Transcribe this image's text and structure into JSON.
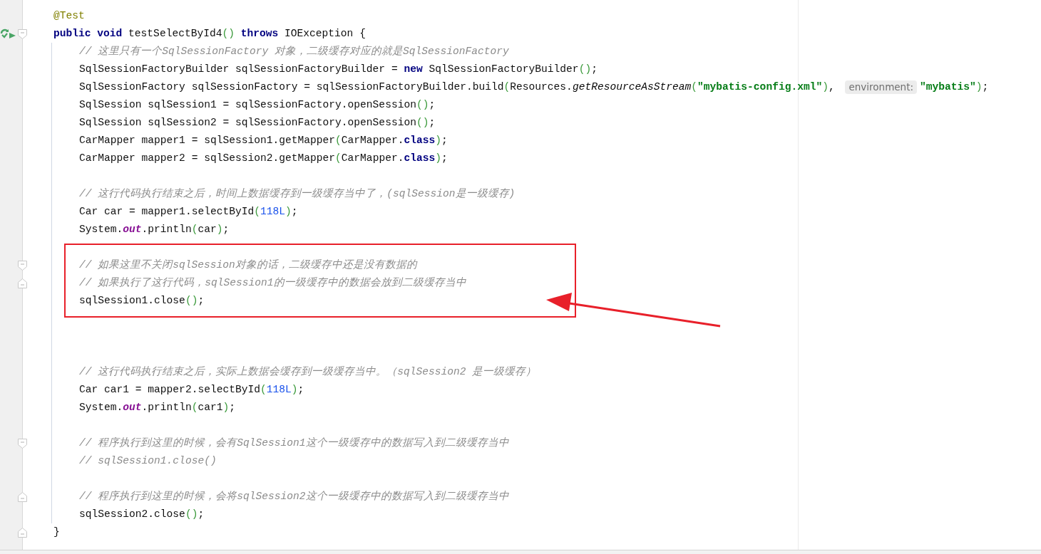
{
  "method": {
    "annotation": {
      "tokens": [
        {
          "kind": "annotation",
          "text": "@Test"
        }
      ]
    },
    "signature": {
      "fold_start": true,
      "run": true,
      "tokens": [
        {
          "kind": "keyword",
          "text": "public void "
        },
        {
          "kind": "plain",
          "text": "testSelectById4"
        },
        {
          "kind": "paren",
          "text": "()"
        },
        {
          "kind": "keyword",
          "text": " throws "
        },
        {
          "kind": "plain",
          "text": "IOException {"
        }
      ]
    },
    "body": [
      {
        "kind": "code",
        "tokens": [
          {
            "kind": "comment",
            "text": "// 这里只有一个SqlSessionFactory 对象，二级缓存对应的就是SqlSessionFactory"
          }
        ]
      },
      {
        "kind": "code",
        "tokens": [
          {
            "kind": "plain",
            "text": "SqlSessionFactoryBuilder sqlSessionFactoryBuilder = "
          },
          {
            "kind": "keyword",
            "text": "new "
          },
          {
            "kind": "plain",
            "text": "SqlSessionFactoryBuilder"
          },
          {
            "kind": "paren",
            "text": "()"
          },
          {
            "kind": "plain",
            "text": ";"
          }
        ]
      },
      {
        "kind": "code",
        "tokens": [
          {
            "kind": "plain",
            "text": "SqlSessionFactory sqlSessionFactory = sqlSessionFactoryBuilder.build"
          },
          {
            "kind": "paren",
            "text": "("
          },
          {
            "kind": "plain",
            "text": "Resources."
          },
          {
            "kind": "italic",
            "text": "getResourceAsStream"
          },
          {
            "kind": "paren",
            "text": "("
          },
          {
            "kind": "string",
            "text": "\"mybatis-config.xml\""
          },
          {
            "kind": "paren",
            "text": ")"
          },
          {
            "kind": "plain",
            "text": ", "
          },
          {
            "kind": "hint",
            "text": "environment:"
          },
          {
            "kind": "string",
            "text": "\"mybatis\""
          },
          {
            "kind": "paren",
            "text": ")"
          },
          {
            "kind": "plain",
            "text": ";"
          }
        ]
      },
      {
        "kind": "code",
        "tokens": [
          {
            "kind": "plain",
            "text": "SqlSession sqlSession1 = sqlSessionFactory.openSession"
          },
          {
            "kind": "paren",
            "text": "()"
          },
          {
            "kind": "plain",
            "text": ";"
          }
        ]
      },
      {
        "kind": "code",
        "tokens": [
          {
            "kind": "plain",
            "text": "SqlSession sqlSession2 = sqlSessionFactory.openSession"
          },
          {
            "kind": "paren",
            "text": "()"
          },
          {
            "kind": "plain",
            "text": ";"
          }
        ]
      },
      {
        "kind": "code",
        "tokens": [
          {
            "kind": "plain",
            "text": "CarMapper mapper1 = sqlSession1.getMapper"
          },
          {
            "kind": "paren",
            "text": "("
          },
          {
            "kind": "plain",
            "text": "CarMapper."
          },
          {
            "kind": "keyword",
            "text": "class"
          },
          {
            "kind": "paren",
            "text": ")"
          },
          {
            "kind": "plain",
            "text": ";"
          }
        ]
      },
      {
        "kind": "code",
        "tokens": [
          {
            "kind": "plain",
            "text": "CarMapper mapper2 = sqlSession2.getMapper"
          },
          {
            "kind": "paren",
            "text": "("
          },
          {
            "kind": "plain",
            "text": "CarMapper."
          },
          {
            "kind": "keyword",
            "text": "class"
          },
          {
            "kind": "paren",
            "text": ")"
          },
          {
            "kind": "plain",
            "text": ";"
          }
        ]
      },
      {
        "kind": "blank"
      },
      {
        "kind": "code",
        "tokens": [
          {
            "kind": "comment",
            "text": "// 这行代码执行结束之后，时间上数据缓存到一级缓存当中了，(sqlSession是一级缓存)"
          }
        ]
      },
      {
        "kind": "code",
        "tokens": [
          {
            "kind": "plain",
            "text": "Car car = mapper1.selectById"
          },
          {
            "kind": "paren",
            "text": "("
          },
          {
            "kind": "number",
            "text": "118L"
          },
          {
            "kind": "paren",
            "text": ")"
          },
          {
            "kind": "plain",
            "text": ";"
          }
        ]
      },
      {
        "kind": "code",
        "tokens": [
          {
            "kind": "plain",
            "text": "System."
          },
          {
            "kind": "static",
            "text": "out"
          },
          {
            "kind": "plain",
            "text": ".println"
          },
          {
            "kind": "paren",
            "text": "("
          },
          {
            "kind": "plain",
            "text": "car"
          },
          {
            "kind": "paren",
            "text": ")"
          },
          {
            "kind": "plain",
            "text": ";"
          }
        ]
      },
      {
        "kind": "blank"
      },
      {
        "kind": "code",
        "fold_start": true,
        "tokens": [
          {
            "kind": "comment",
            "text": "// 如果这里不关闭sqlSession对象的话，二级缓存中还是没有数据的"
          }
        ]
      },
      {
        "kind": "code",
        "fold_end": true,
        "tokens": [
          {
            "kind": "comment",
            "text": "// 如果执行了这行代码，sqlSession1的一级缓存中的数据会放到二级缓存当中"
          }
        ]
      },
      {
        "kind": "code",
        "tokens": [
          {
            "kind": "plain",
            "text": "sqlSession1.close"
          },
          {
            "kind": "paren",
            "text": "()"
          },
          {
            "kind": "plain",
            "text": ";"
          }
        ]
      },
      {
        "kind": "blank"
      },
      {
        "kind": "blank"
      },
      {
        "kind": "blank"
      },
      {
        "kind": "code",
        "tokens": [
          {
            "kind": "comment",
            "text": "// 这行代码执行结束之后，实际上数据会缓存到一级缓存当中。（sqlSession2 是一级缓存）"
          }
        ]
      },
      {
        "kind": "code",
        "tokens": [
          {
            "kind": "plain",
            "text": "Car car1 = mapper2.selectById"
          },
          {
            "kind": "paren",
            "text": "("
          },
          {
            "kind": "number",
            "text": "118L"
          },
          {
            "kind": "paren",
            "text": ")"
          },
          {
            "kind": "plain",
            "text": ";"
          }
        ]
      },
      {
        "kind": "code",
        "tokens": [
          {
            "kind": "plain",
            "text": "System."
          },
          {
            "kind": "static",
            "text": "out"
          },
          {
            "kind": "plain",
            "text": ".println"
          },
          {
            "kind": "paren",
            "text": "("
          },
          {
            "kind": "plain",
            "text": "car1"
          },
          {
            "kind": "paren",
            "text": ")"
          },
          {
            "kind": "plain",
            "text": ";"
          }
        ]
      },
      {
        "kind": "blank"
      },
      {
        "kind": "code",
        "fold_start": true,
        "tokens": [
          {
            "kind": "comment",
            "text": "// 程序执行到这里的时候，会有SqlSession1这个一级缓存中的数据写入到二级缓存当中"
          }
        ]
      },
      {
        "kind": "code",
        "tokens": [
          {
            "kind": "comment",
            "text": "// sqlSession1.close()"
          }
        ]
      },
      {
        "kind": "blank"
      },
      {
        "kind": "code",
        "fold_end": true,
        "tokens": [
          {
            "kind": "comment",
            "text": "// 程序执行到这里的时候，会将sqlSession2这个一级缓存中的数据写入到二级缓存当中"
          }
        ]
      },
      {
        "kind": "code",
        "tokens": [
          {
            "kind": "plain",
            "text": "sqlSession2.close"
          },
          {
            "kind": "paren",
            "text": "()"
          },
          {
            "kind": "plain",
            "text": ";"
          }
        ]
      }
    ],
    "closing": {
      "fold_end": true,
      "tokens": [
        {
          "kind": "plain",
          "text": "}"
        }
      ]
    }
  }
}
